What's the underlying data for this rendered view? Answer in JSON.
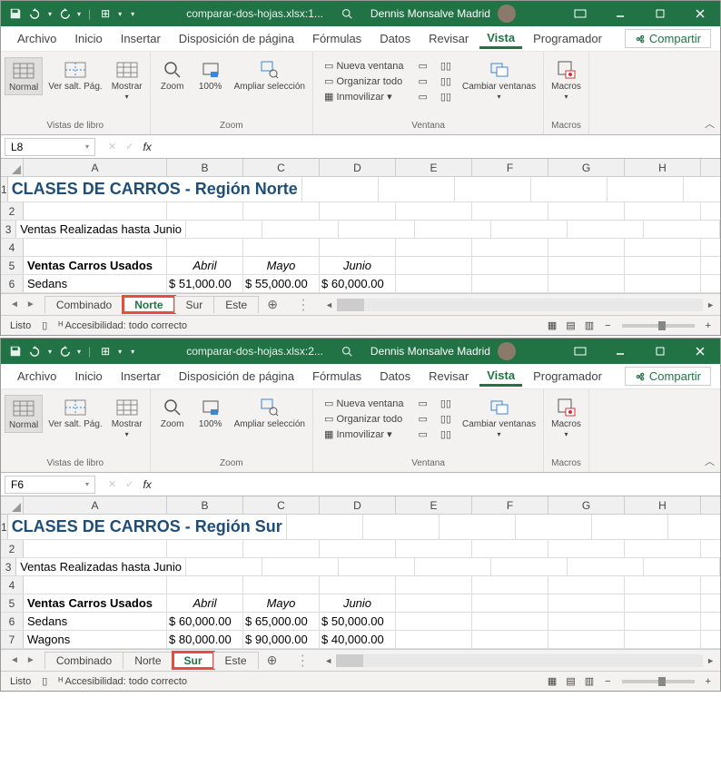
{
  "windows": [
    {
      "filename": "comparar-dos-hojas.xlsx:1...",
      "user": "Dennis Monsalve Madrid",
      "namebox": "L8",
      "title_cell": "CLASES DE CARROS - Región Norte",
      "subtitle": "Ventas Realizadas hasta Junio",
      "row5_label": "Ventas Carros Usados",
      "months": {
        "b": "Abril",
        "c": "Mayo",
        "d": "Junio"
      },
      "data_rows": [
        {
          "a": "Sedans",
          "b": "$   51,000.00",
          "c": "$   55,000.00",
          "d": "$   60,000.00"
        }
      ],
      "active_tab": "Norte",
      "highlight_tab": "Norte",
      "row_numbers": [
        1,
        2,
        3,
        4,
        5,
        6
      ]
    },
    {
      "filename": "comparar-dos-hojas.xlsx:2...",
      "user": "Dennis Monsalve Madrid",
      "namebox": "F6",
      "title_cell": "CLASES DE CARROS - Región Sur",
      "subtitle": "Ventas Realizadas hasta Junio",
      "row5_label": "Ventas Carros Usados",
      "months": {
        "b": "Abril",
        "c": "Mayo",
        "d": "Junio"
      },
      "data_rows": [
        {
          "a": "Sedans",
          "b": "$   60,000.00",
          "c": "$   65,000.00",
          "d": "$   50,000.00"
        },
        {
          "a": "Wagons",
          "b": "$   80,000.00",
          "c": "$   90,000.00",
          "d": "$   40,000.00"
        }
      ],
      "active_tab": "Sur",
      "highlight_tab": "Sur",
      "row_numbers": [
        1,
        2,
        3,
        4,
        5,
        6,
        7
      ]
    }
  ],
  "menu": [
    "Archivo",
    "Inicio",
    "Insertar",
    "Disposición de página",
    "Fórmulas",
    "Datos",
    "Revisar",
    "Vista",
    "Programador"
  ],
  "active_menu": "Vista",
  "share": "Compartir",
  "ribbon": {
    "g1": {
      "label": "Vistas de libro",
      "normal": "Normal",
      "salto": "Ver salt. Pág.",
      "mostrar": "Mostrar"
    },
    "g2": {
      "label": "Zoom",
      "zoom": "Zoom",
      "cien": "100%",
      "sel": "Ampliar selección"
    },
    "g3": {
      "label": "Ventana",
      "nueva": "Nueva ventana",
      "org": "Organizar todo",
      "inm": "Inmovilizar",
      "cambiar": "Cambiar ventanas"
    },
    "g4": {
      "label": "Macros",
      "macros": "Macros"
    }
  },
  "sheet_tabs": [
    "Combinado",
    "Norte",
    "Sur",
    "Este"
  ],
  "cols": [
    "A",
    "B",
    "C",
    "D",
    "E",
    "F",
    "G",
    "H"
  ],
  "status": {
    "ready": "Listo",
    "access": "Accesibilidad: todo correcto"
  }
}
